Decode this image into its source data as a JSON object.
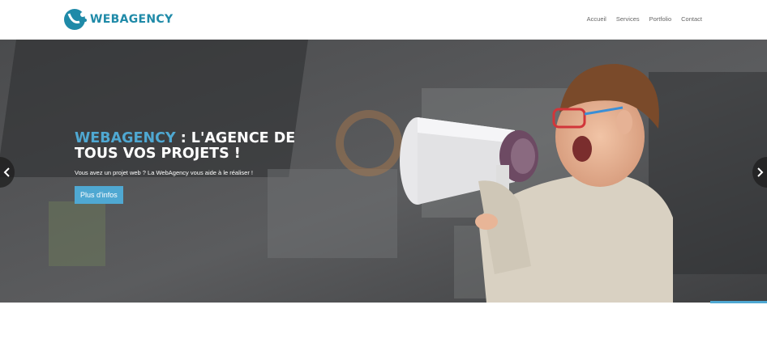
{
  "brand": {
    "name": "WEBAGENCY",
    "accent_color": "#4fa8d2",
    "logo_color": "#1f8aa8"
  },
  "nav": {
    "items": [
      {
        "label": "Accueil"
      },
      {
        "label": "Services"
      },
      {
        "label": "Portfolio"
      },
      {
        "label": "Contact"
      }
    ]
  },
  "hero": {
    "title_accent": "WEBAGENCY",
    "title_rest": " : L'AGENCE DE TOUS VOS PROJETS !",
    "subtitle": "Vous avez un projet web ? La WebAgency vous aide à le réaliser !",
    "button_label": "Plus d'infos",
    "prev_icon": "chevron-left-icon",
    "next_icon": "chevron-right-icon"
  }
}
